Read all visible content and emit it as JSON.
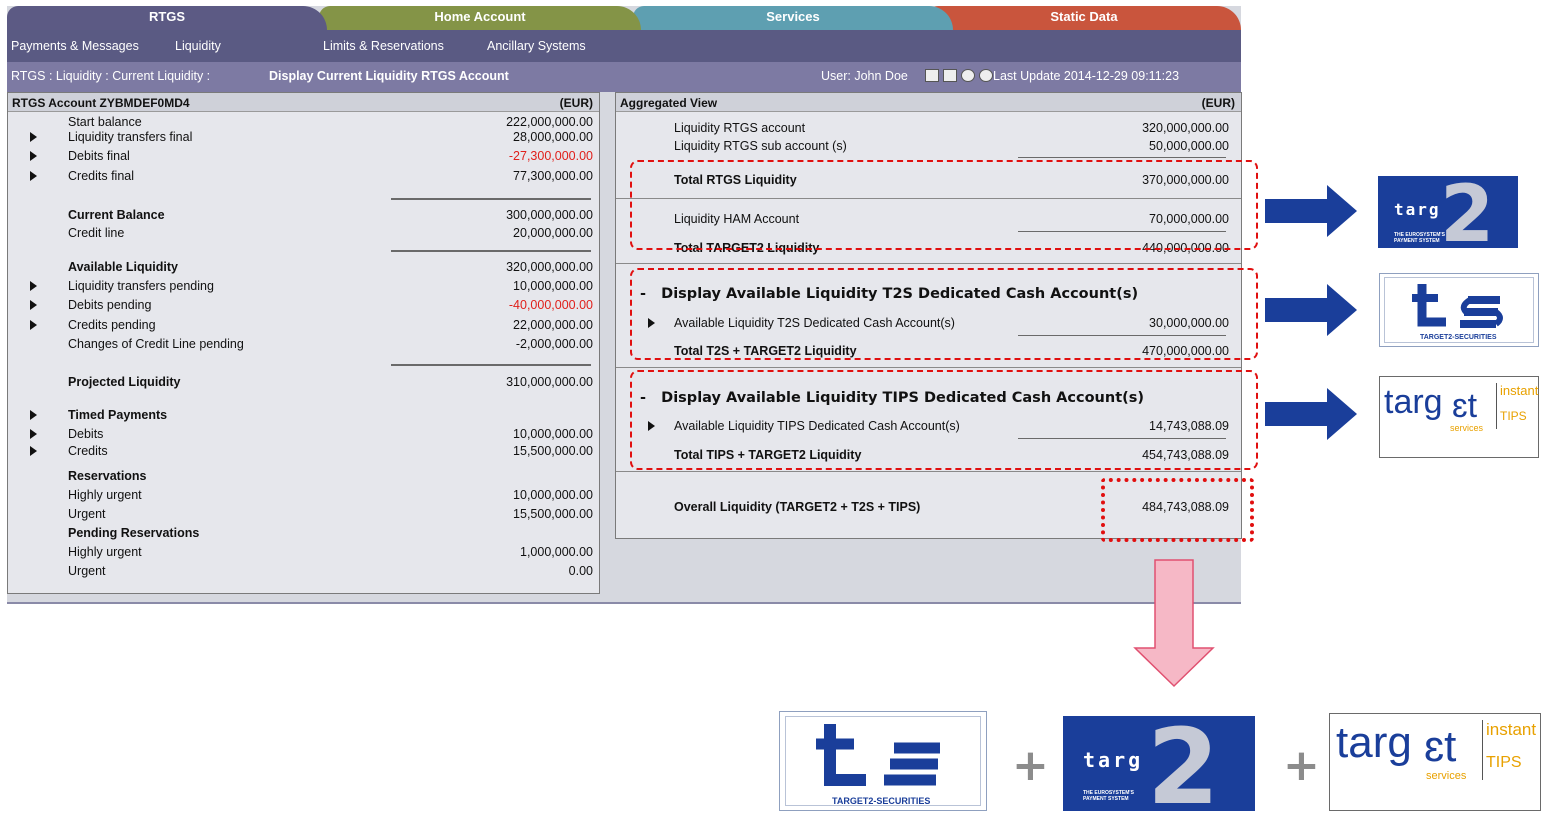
{
  "tabs": [
    "RTGS",
    "Home Account",
    "Services",
    "Static Data"
  ],
  "subnav": [
    "Payments & Messages",
    "Liquidity",
    "Limits & Reservations",
    "Ancillary Systems"
  ],
  "breadcrumb": {
    "path": "RTGS : Liquidity : Current Liquidity :",
    "current": "Display Current Liquidity RTGS Account",
    "user": "User: John Doe",
    "last_update": "Last Update 2014-12-29  09:11:23"
  },
  "left": {
    "title": "RTGS Account ZYBMDEF0MD4",
    "currency": "(EUR)",
    "rows": [
      {
        "label": "Start balance",
        "value": "222,000,000.00"
      },
      {
        "label": "Liquidity transfers final",
        "value": "28,000,000.00"
      },
      {
        "label": "Debits final",
        "value": "-27,300,000.00"
      },
      {
        "label": "Credits final",
        "value": "77,300,000.00"
      },
      {
        "label": "Current Balance",
        "value": "300,000,000.00"
      },
      {
        "label": "Credit line",
        "value": "20,000,000.00"
      },
      {
        "label": "Available Liquidity",
        "value": "320,000,000.00"
      },
      {
        "label": "Liquidity transfers pending",
        "value": "10,000,000.00"
      },
      {
        "label": "Debits pending",
        "value": "-40,000,000.00"
      },
      {
        "label": "Credits pending",
        "value": "22,000,000.00"
      },
      {
        "label": "Changes of Credit Line pending",
        "value": "-2,000,000.00"
      },
      {
        "label": "Projected Liquidity",
        "value": "310,000,000.00"
      },
      {
        "label": "Timed Payments",
        "value": ""
      },
      {
        "label": "Debits",
        "value": "10,000,000.00"
      },
      {
        "label": "Credits",
        "value": "15,500,000.00"
      },
      {
        "label": "Reservations",
        "value": ""
      },
      {
        "label": "Highly urgent",
        "value": "10,000,000.00"
      },
      {
        "label": "Urgent",
        "value": "15,500,000.00"
      },
      {
        "label": "Pending Reservations",
        "value": ""
      },
      {
        "label": "Highly urgent",
        "value": "1,000,000.00"
      },
      {
        "label": "Urgent",
        "value": "0.00"
      }
    ]
  },
  "right": {
    "title": "Aggregated View",
    "currency": "(EUR)",
    "rtgs_account": {
      "label": "Liquidity RTGS account",
      "value": "320,000,000.00"
    },
    "rtgs_sub": {
      "label": "Liquidity RTGS sub account (s)",
      "value": "50,000,000.00"
    },
    "total_rtgs": {
      "label": "Total RTGS Liquidity",
      "value": "370,000,000.00"
    },
    "ham": {
      "label": "Liquidity HAM Account",
      "value": "70,000,000.00"
    },
    "total_t2": {
      "label": "Total TARGET2 Liquidity",
      "value": "440,000,000.00"
    },
    "t2s_header": "Display Available Liquidity T2S Dedicated Cash Account(s)",
    "t2s_avail": {
      "label": "Available Liquidity T2S Dedicated Cash Account(s)",
      "value": "30,000,000.00"
    },
    "t2s_total": {
      "label": "Total T2S + TARGET2 Liquidity",
      "value": "470,000,000.00"
    },
    "tips_header": "Display Available Liquidity TIPS Dedicated Cash Account(s)",
    "tips_avail": {
      "label": "Available Liquidity TIPS Dedicated Cash Account(s)",
      "value": "14,743,088.09"
    },
    "tips_total": {
      "label": "Total TIPS + TARGET2 Liquidity",
      "value": "454,743,088.09"
    },
    "overall": {
      "label": "Overall Liquidity (TARGET2 + T2S + TIPS)",
      "value": "484,743,088.09"
    }
  },
  "logos": {
    "target2_word": "targ",
    "target2_small": "THE EUROSYSTEM'S PAYMENT SYSTEM",
    "t2s_caption": "TARGET2-SECURITIES",
    "tips_word": "targ",
    "tips_services": "services",
    "tips_instant": "instant",
    "tips_name": "TIPS"
  },
  "plus": "+",
  "colors": {
    "highlight": "#e10f0f",
    "arrow_blue": "#1a3e9a",
    "arrow_pink": "#f6b8c6"
  }
}
